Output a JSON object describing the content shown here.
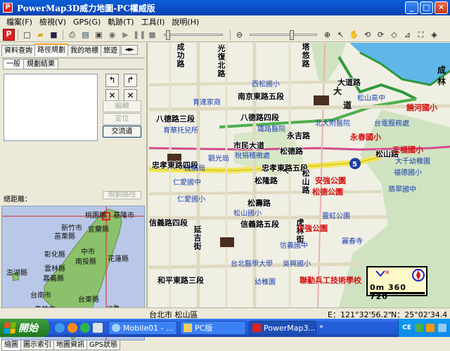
{
  "window": {
    "title": "PowerMap3D威力地圖-PC權威版",
    "icon_letter": "P",
    "min_label": "_",
    "max_label": "□",
    "close_label": "✕"
  },
  "menu": [
    "檔案(F)",
    "檢視(V)",
    "GPS(G)",
    "軌跡(T)",
    "工具(I)",
    "說明(H)"
  ],
  "left_panel": {
    "tabs": [
      "資料查詢",
      "路徑規劃",
      "我的地標",
      "旅遊"
    ],
    "active_tab": "路徑規劃",
    "tab_scroll": "◄►",
    "subtabs": [
      "一般",
      "規劃結果"
    ],
    "buttons": {
      "edit": "編輯",
      "locate": "定位",
      "interchange": "交流道",
      "plan": "規劃路徑"
    },
    "distance_label": "總距離：",
    "distance_value": ""
  },
  "mini_map": {
    "labels": [
      "桃園縣",
      "基隆市",
      "新竹市",
      "宜蘭縣",
      "苗栗縣",
      "中市",
      "彰化縣",
      "南投縣",
      "花蓮縣",
      "澎湖縣",
      "雲林縣",
      "嘉義縣",
      "台南市",
      "台東縣",
      "高雄市",
      "綠島"
    ]
  },
  "bottom_tabs": [
    "縮圖",
    "圖示索引",
    "地圖資訊",
    "GPS狀態"
  ],
  "map": {
    "roads": [
      "南京東路五段",
      "八德路三段",
      "八德路四段",
      "市民大道",
      "忠孝東路五段",
      "永吉路",
      "松隆路",
      "松山路",
      "松德路",
      "忠孝東路四段",
      "松壽路",
      "信義路四段",
      "信義路五段",
      "和平東路三段",
      "延吉街",
      "光復北路",
      "塔悠路",
      "大道路",
      "虎林街",
      "成功路",
      "松山路"
    ],
    "pois": [
      "西松國小",
      "育達家商",
      "松山高中",
      "鐵路醫院",
      "育華托兒所",
      "稅捐稽徵處",
      "觀光局",
      "稅捐局",
      "仁愛國中",
      "仁愛國小",
      "松山國小",
      "台北醫學大學",
      "信義國中",
      "吳興國小",
      "北大附醫院",
      "台電服務處",
      "大千幼稚園",
      "福德國小",
      "翡翠國中",
      "麗春寺",
      "豐虹公園",
      "幼稚園"
    ],
    "red_labels": [
      "饒河國小",
      "永春國小",
      "五福國小",
      "安強公園",
      "松德公園",
      "中強公園",
      "聯勤兵工技術學校"
    ],
    "places": [
      "大",
      "道",
      "成",
      "林"
    ],
    "highway_shield": "5",
    "scale": "0m 360 720",
    "scale_unit": "m"
  },
  "status": {
    "location": "台北市 松山區",
    "lon": "E：121°32'56.2\"",
    "lat": "N：25°02'34.4"
  },
  "taskbar": {
    "start_label": "開始",
    "tasks": [
      "Mobile01 - ...",
      "PC版",
      "PowerMap3..."
    ],
    "lang": "CE",
    "clock": ""
  },
  "colors": {
    "titlebar": "#0b4cc2",
    "accent": "#f7a326",
    "map_bg": "#f0efe4",
    "park": "#cfe3c1",
    "river": "#5fb6e8",
    "highway": "#f2e65a",
    "railway": "#d44a8c"
  }
}
